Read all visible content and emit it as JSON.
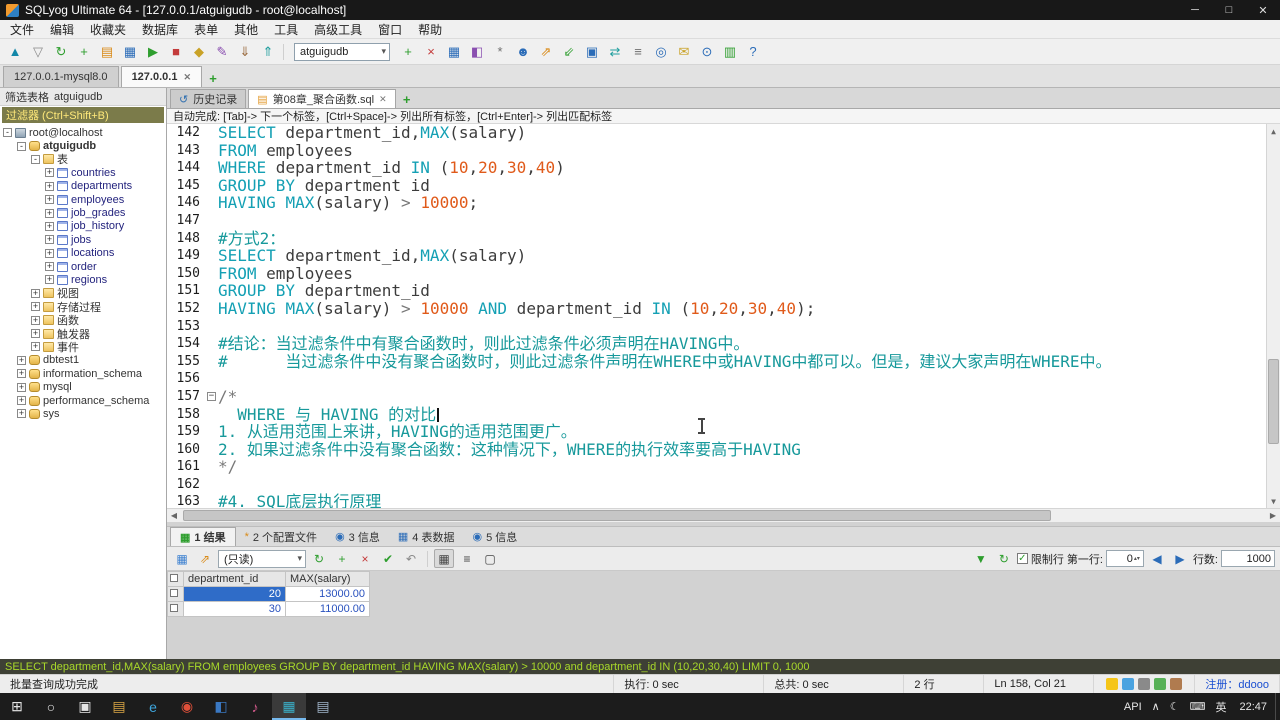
{
  "window": {
    "title": "SQLyog Ultimate 64 - [127.0.0.1/atguigudb - root@localhost]",
    "controls": {
      "minimize": "─",
      "maximize": "□",
      "close": "✕"
    }
  },
  "menu": {
    "items": [
      "文件",
      "编辑",
      "收藏夹",
      "数据库",
      "表单",
      "其他",
      "工具",
      "高级工具",
      "窗口",
      "帮助"
    ]
  },
  "toolbar": {
    "left_icons": [
      {
        "name": "connect-icon",
        "glyph": "▲",
        "color": "#1287a8"
      },
      {
        "name": "disconnect-icon",
        "glyph": "▽",
        "color": "#8a8a8a"
      },
      {
        "name": "refresh-object-browser-icon",
        "glyph": "↻",
        "color": "#2e9e2e"
      },
      {
        "name": "new-query-editor-icon",
        "glyph": "+",
        "color": "#2e9e2e"
      },
      {
        "name": "open-query-icon",
        "glyph": "▤",
        "color": "#d98a17"
      },
      {
        "name": "save-query-icon",
        "glyph": "▦",
        "color": "#2b6cb8"
      },
      {
        "name": "execute-query-icon",
        "glyph": "▶",
        "color": "#2e9e2e"
      },
      {
        "name": "stop-query-icon",
        "glyph": "■",
        "color": "#c43b3b"
      },
      {
        "name": "new-database-icon",
        "glyph": "◆",
        "color": "#c9a227"
      },
      {
        "name": "alter-table-icon",
        "glyph": "✎",
        "color": "#8a4fb0"
      },
      {
        "name": "backup-icon",
        "glyph": "⇓",
        "color": "#9a6b3f"
      },
      {
        "name": "restore-icon",
        "glyph": "⇑",
        "color": "#1f9e9e"
      }
    ],
    "db_selector": {
      "value": "atguigudb"
    },
    "right_icons": [
      {
        "name": "insert-row-icon",
        "glyph": "+",
        "color": "#2e9e2e"
      },
      {
        "name": "delete-row-icon",
        "glyph": "×",
        "color": "#c43b3b"
      },
      {
        "name": "table-data-icon",
        "glyph": "▦",
        "color": "#2b6cb8"
      },
      {
        "name": "schema-designer-icon",
        "glyph": "◧",
        "color": "#8a4fb0"
      },
      {
        "name": "query-builder-icon",
        "glyph": "*",
        "color": "#707070"
      },
      {
        "name": "user-manager-icon",
        "glyph": "☻",
        "color": "#2b6cb8"
      },
      {
        "name": "export-icon",
        "glyph": "⇗",
        "color": "#d98a17"
      },
      {
        "name": "import-icon",
        "glyph": "⇙",
        "color": "#2e9e2e"
      },
      {
        "name": "copy-database-icon",
        "glyph": "▣",
        "color": "#2b6cb8"
      },
      {
        "name": "sync-icon",
        "glyph": "⇄",
        "color": "#1f9e9e"
      },
      {
        "name": "format-sql-icon",
        "glyph": "≡",
        "color": "#707070"
      },
      {
        "name": "find-icon",
        "glyph": "◎",
        "color": "#2b6cb8"
      },
      {
        "name": "mail-icon",
        "glyph": "✉",
        "color": "#c9a227"
      },
      {
        "name": "scheduler-icon",
        "glyph": "⊙",
        "color": "#2b6cb8"
      },
      {
        "name": "report-icon",
        "glyph": "▥",
        "color": "#2e9e2e"
      },
      {
        "name": "help-icon",
        "glyph": "?",
        "color": "#2b6cb8"
      }
    ]
  },
  "connection_tabs": {
    "add_label": "+",
    "tabs": [
      {
        "label": "127.0.0.1-mysql8.0",
        "active": false,
        "closable": false
      },
      {
        "label": "127.0.0.1",
        "active": true,
        "closable": true
      }
    ]
  },
  "sidebar": {
    "filter_title": "筛选表格",
    "filter_db": "atguigudb",
    "filter_label": "过滤器 (Ctrl+Shift+B)",
    "tree": [
      {
        "depth": 0,
        "expand": "-",
        "icon": "server",
        "label": "root@localhost"
      },
      {
        "depth": 1,
        "expand": "-",
        "icon": "db",
        "label": "atguigudb",
        "bold": true
      },
      {
        "depth": 2,
        "expand": "-",
        "icon": "folder",
        "label": "表"
      },
      {
        "depth": 3,
        "expand": "+",
        "icon": "table",
        "label": "countries",
        "tbl": true
      },
      {
        "depth": 3,
        "expand": "+",
        "icon": "table",
        "label": "departments",
        "tbl": true
      },
      {
        "depth": 3,
        "expand": "+",
        "icon": "table",
        "label": "employees",
        "tbl": true
      },
      {
        "depth": 3,
        "expand": "+",
        "icon": "table",
        "label": "job_grades",
        "tbl": true
      },
      {
        "depth": 3,
        "expand": "+",
        "icon": "table",
        "label": "job_history",
        "tbl": true
      },
      {
        "depth": 3,
        "expand": "+",
        "icon": "table",
        "label": "jobs",
        "tbl": true
      },
      {
        "depth": 3,
        "expand": "+",
        "icon": "table",
        "label": "locations",
        "tbl": true
      },
      {
        "depth": 3,
        "expand": "+",
        "icon": "table",
        "label": "order",
        "tbl": true
      },
      {
        "depth": 3,
        "expand": "+",
        "icon": "table",
        "label": "regions",
        "tbl": true
      },
      {
        "depth": 2,
        "expand": "+",
        "icon": "folder",
        "label": "视图"
      },
      {
        "depth": 2,
        "expand": "+",
        "icon": "folder",
        "label": "存储过程"
      },
      {
        "depth": 2,
        "expand": "+",
        "icon": "folder",
        "label": "函数"
      },
      {
        "depth": 2,
        "expand": "+",
        "icon": "folder",
        "label": "触发器"
      },
      {
        "depth": 2,
        "expand": "+",
        "icon": "folder",
        "label": "事件"
      },
      {
        "depth": 1,
        "expand": "+",
        "icon": "db",
        "label": "dbtest1"
      },
      {
        "depth": 1,
        "expand": "+",
        "icon": "db",
        "label": "information_schema"
      },
      {
        "depth": 1,
        "expand": "+",
        "icon": "db",
        "label": "mysql"
      },
      {
        "depth": 1,
        "expand": "+",
        "icon": "db",
        "label": "performance_schema"
      },
      {
        "depth": 1,
        "expand": "+",
        "icon": "db",
        "label": "sys"
      }
    ]
  },
  "editor": {
    "add_label": "+",
    "tabs": [
      {
        "icon_name": "history-icon",
        "icon_glyph": "↺",
        "icon_color": "#2e6fb0",
        "label": "历史记录",
        "active": false,
        "closable": false
      },
      {
        "icon_name": "sql-file-icon",
        "icon_glyph": "▤",
        "icon_color": "#e39a2d",
        "label": "第08章_聚合函数.sql",
        "active": true,
        "closable": true
      }
    ],
    "hint": "自动完成: [Tab]-> 下一个标签，[Ctrl+Space]-> 列出所有标签，[Ctrl+Enter]-> 列出匹配标签",
    "lines": [
      {
        "no": "142",
        "segs": [
          [
            "k",
            "SELECT"
          ],
          [
            "t",
            " department_id,"
          ],
          [
            "k",
            "MAX"
          ],
          [
            "t",
            "(salary)"
          ]
        ]
      },
      {
        "no": "143",
        "segs": [
          [
            "k",
            "FROM"
          ],
          [
            "t",
            " employees"
          ]
        ]
      },
      {
        "no": "144",
        "segs": [
          [
            "k",
            "WHERE"
          ],
          [
            "t",
            " department_id "
          ],
          [
            "k",
            "IN"
          ],
          [
            "t",
            " ("
          ],
          [
            "n",
            "10"
          ],
          [
            "t",
            ","
          ],
          [
            "n",
            "20"
          ],
          [
            "t",
            ","
          ],
          [
            "n",
            "30"
          ],
          [
            "t",
            ","
          ],
          [
            "n",
            "40"
          ],
          [
            "t",
            ")"
          ]
        ]
      },
      {
        "no": "145",
        "segs": [
          [
            "k",
            "GROUP BY"
          ],
          [
            "t",
            " department_id"
          ]
        ]
      },
      {
        "no": "146",
        "segs": [
          [
            "k",
            "HAVING"
          ],
          [
            "t",
            " "
          ],
          [
            "k",
            "MAX"
          ],
          [
            "t",
            "(salary) "
          ],
          [
            "g",
            ">"
          ],
          [
            "t",
            " "
          ],
          [
            "n",
            "10000"
          ],
          [
            "t",
            ";"
          ]
        ]
      },
      {
        "no": "147",
        "segs": []
      },
      {
        "no": "148",
        "segs": [
          [
            "c",
            "#方式2："
          ]
        ]
      },
      {
        "no": "149",
        "segs": [
          [
            "k",
            "SELECT"
          ],
          [
            "t",
            " department_id,"
          ],
          [
            "k",
            "MAX"
          ],
          [
            "t",
            "(salary)"
          ]
        ]
      },
      {
        "no": "150",
        "segs": [
          [
            "k",
            "FROM"
          ],
          [
            "t",
            " employees"
          ]
        ]
      },
      {
        "no": "151",
        "segs": [
          [
            "k",
            "GROUP BY"
          ],
          [
            "t",
            " department_id"
          ]
        ]
      },
      {
        "no": "152",
        "segs": [
          [
            "k",
            "HAVING"
          ],
          [
            "t",
            " "
          ],
          [
            "k",
            "MAX"
          ],
          [
            "t",
            "(salary) "
          ],
          [
            "g",
            ">"
          ],
          [
            "t",
            " "
          ],
          [
            "n",
            "10000"
          ],
          [
            "t",
            " "
          ],
          [
            "k",
            "AND"
          ],
          [
            "t",
            " department_id "
          ],
          [
            "k",
            "IN"
          ],
          [
            "t",
            " ("
          ],
          [
            "n",
            "10"
          ],
          [
            "t",
            ","
          ],
          [
            "n",
            "20"
          ],
          [
            "t",
            ","
          ],
          [
            "n",
            "30"
          ],
          [
            "t",
            ","
          ],
          [
            "n",
            "40"
          ],
          [
            "t",
            ");"
          ]
        ]
      },
      {
        "no": "153",
        "segs": []
      },
      {
        "no": "154",
        "segs": [
          [
            "c",
            "#结论：当过滤条件中有聚合函数时，则此过滤条件必须声明在HAVING中。"
          ]
        ]
      },
      {
        "no": "155",
        "segs": [
          [
            "c",
            "#      当过滤条件中没有聚合函数时，则此过滤条件声明在WHERE中或HAVING中都可以。但是，建议大家声明在WHERE中。"
          ]
        ]
      },
      {
        "no": "156",
        "segs": []
      },
      {
        "no": "157",
        "fold": true,
        "segs": [
          [
            "g",
            "/*"
          ]
        ]
      },
      {
        "no": "158",
        "caret": true,
        "segs": [
          [
            "c",
            "  WHERE 与 HAVING 的对比"
          ]
        ]
      },
      {
        "no": "159",
        "segs": [
          [
            "c",
            "1. 从适用范围上来讲，HAVING的适用范围更广。"
          ]
        ]
      },
      {
        "no": "160",
        "segs": [
          [
            "c",
            "2. 如果过滤条件中没有聚合函数：这种情况下，WHERE的执行效率要高于HAVING"
          ]
        ]
      },
      {
        "no": "161",
        "segs": [
          [
            "g",
            "*/"
          ]
        ]
      },
      {
        "no": "162",
        "segs": []
      },
      {
        "no": "163",
        "segs": [
          [
            "c",
            "#4. SQL底层执行原理"
          ]
        ]
      }
    ]
  },
  "results": {
    "tabs": [
      {
        "num": "1",
        "label": "结果",
        "glyph": "▦",
        "color": "#2e9e2e",
        "active": true
      },
      {
        "num": "2",
        "label": "个配置文件",
        "glyph": "*",
        "color": "#d98a17",
        "active": false
      },
      {
        "num": "3",
        "label": "信息",
        "glyph": "◉",
        "color": "#2b6cb8",
        "active": false
      },
      {
        "num": "4",
        "label": "表数据",
        "glyph": "▦",
        "color": "#2b6cb8",
        "active": false
      },
      {
        "num": "5",
        "label": "信息",
        "glyph": "◉",
        "color": "#2b6cb8",
        "active": false
      }
    ],
    "toolbar": {
      "left_icons": [
        {
          "name": "result-grid-icon",
          "glyph": "▦",
          "color": "#3a7fd0"
        },
        {
          "name": "export-result-icon",
          "glyph": "⇗",
          "color": "#d98a17"
        }
      ],
      "readonly": "(只读)",
      "mid_icons": [
        {
          "name": "refresh-result-icon",
          "glyph": "↻",
          "color": "#2e9e2e"
        },
        {
          "name": "add-row-icon",
          "glyph": "+",
          "color": "#2e9e2e"
        },
        {
          "name": "delete-row-icon",
          "glyph": "×",
          "color": "#c43b3b"
        },
        {
          "name": "save-row-icon",
          "glyph": "✔",
          "color": "#2e9e2e"
        },
        {
          "name": "revert-row-icon",
          "glyph": "↶",
          "color": "#888888"
        }
      ],
      "view_icons": [
        {
          "name": "grid-view-icon",
          "glyph": "▦",
          "color": "#444444",
          "pressed": true
        },
        {
          "name": "text-view-icon",
          "glyph": "≡",
          "color": "#444444",
          "pressed": false
        },
        {
          "name": "form-view-icon",
          "glyph": "▢",
          "color": "#444444",
          "pressed": false
        }
      ],
      "filter_glyph": "▼",
      "sync_glyph": "↻",
      "limit_checked": "✓",
      "limit_label": "限制行",
      "first_row_label": "第一行:",
      "first_row_value": "0",
      "prev_glyph": "◀",
      "next_glyph": "▶",
      "row_count_label": "行数:",
      "row_count_value": "1000"
    },
    "grid": {
      "columns": [
        "department_id",
        "MAX(salary)"
      ],
      "rows": [
        [
          "20",
          "13000.00"
        ],
        [
          "30",
          "11000.00"
        ]
      ],
      "selected": {
        "row": 0,
        "col": 0
      }
    }
  },
  "query_bar": {
    "text": "SELECT department_id,MAX(salary) FROM employees GROUP BY department_id HAVING MAX(salary) > 10000 and department_id IN (10,20,30,40) LIMIT 0, 1000"
  },
  "status": {
    "message": "批量查询成功完成",
    "exec": "执行: 0 sec",
    "total": "总共: 0 sec",
    "rows": "2 行",
    "position": "Ln 158, Col 21",
    "register": "注册：ddooo"
  },
  "taskbar": {
    "start": "⊞",
    "items": [
      {
        "name": "search-icon",
        "glyph": "○",
        "color": "#e6e6e6",
        "active": false
      },
      {
        "name": "task-view-icon",
        "glyph": "▣",
        "color": "#e6e6e6",
        "active": false
      },
      {
        "name": "file-explorer-icon",
        "glyph": "▤",
        "color": "#d9a545",
        "active": false
      },
      {
        "name": "edge-browser-icon",
        "glyph": "e",
        "color": "#3ea6dd",
        "active": false
      },
      {
        "name": "chrome-browser-icon",
        "glyph": "◉",
        "color": "#e0503a",
        "active": false
      },
      {
        "name": "vscode-icon",
        "glyph": "◧",
        "color": "#3a78c2",
        "active": false
      },
      {
        "name": "media-player-icon",
        "glyph": "♪",
        "color": "#d45a8c",
        "active": false
      },
      {
        "name": "sqlyog-taskbar-icon",
        "glyph": "▦",
        "color": "#3bb0c9",
        "active": true
      },
      {
        "name": "notepad-icon",
        "glyph": "▤",
        "color": "#9fb3c8",
        "active": false
      }
    ],
    "tray": [
      "API",
      "∧",
      "☾",
      "⌨",
      "英"
    ],
    "clock": "22:47"
  }
}
